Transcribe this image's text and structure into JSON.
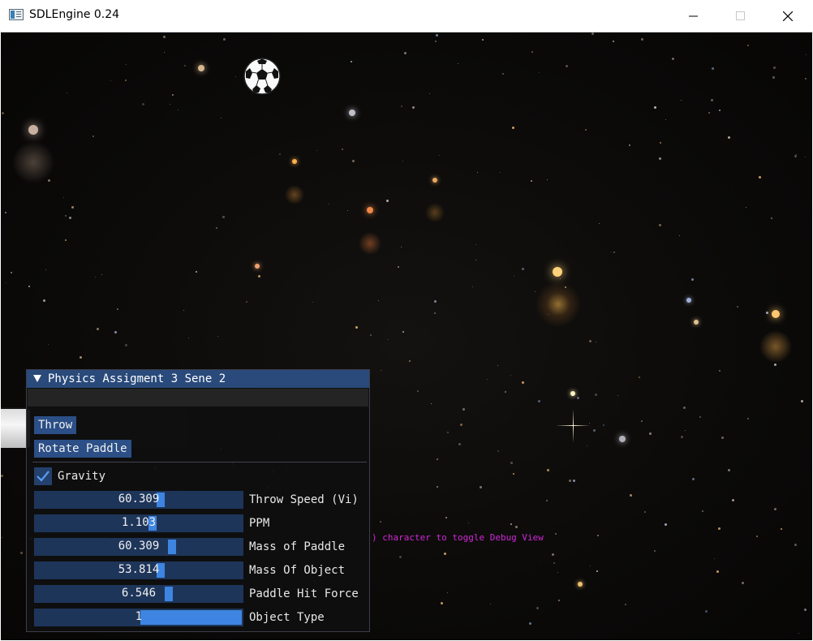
{
  "window": {
    "title": "SDLEngine 0.24",
    "controls": [
      "minimize-icon",
      "maximize-icon",
      "close-icon"
    ]
  },
  "scene": {
    "background": "deep-field-starfield",
    "ball_icon": "soccer-ball-icon",
    "debug_hint": ") character to toggle Debug View",
    "debug_hint_color": "#d127d8"
  },
  "panel": {
    "title": "Physics Assigment 3 Sene 2",
    "collapse_icon": "triangle-down-icon",
    "buttons": {
      "throw": "Throw",
      "rotate_paddle": "Rotate Paddle"
    },
    "gravity": {
      "label": "Gravity",
      "checked": true
    },
    "sliders": [
      {
        "label": "Throw Speed (Vi)",
        "value": "60.309",
        "fill_fraction": 0.61
      },
      {
        "label": "PPM",
        "value": "1.103",
        "fill_fraction": 0.57
      },
      {
        "label": "Mass of Paddle",
        "value": "60.309",
        "fill_fraction": 0.67
      },
      {
        "label": "Mass Of Object",
        "value": "53.814",
        "fill_fraction": 0.61
      },
      {
        "label": "Paddle Hit Force",
        "value": "6.546",
        "fill_fraction": 0.65
      },
      {
        "label": "Object Type",
        "value": "1",
        "fill_fraction": 1.0
      }
    ],
    "accent_color": "#3d85e0",
    "title_color": "#294a7a"
  }
}
